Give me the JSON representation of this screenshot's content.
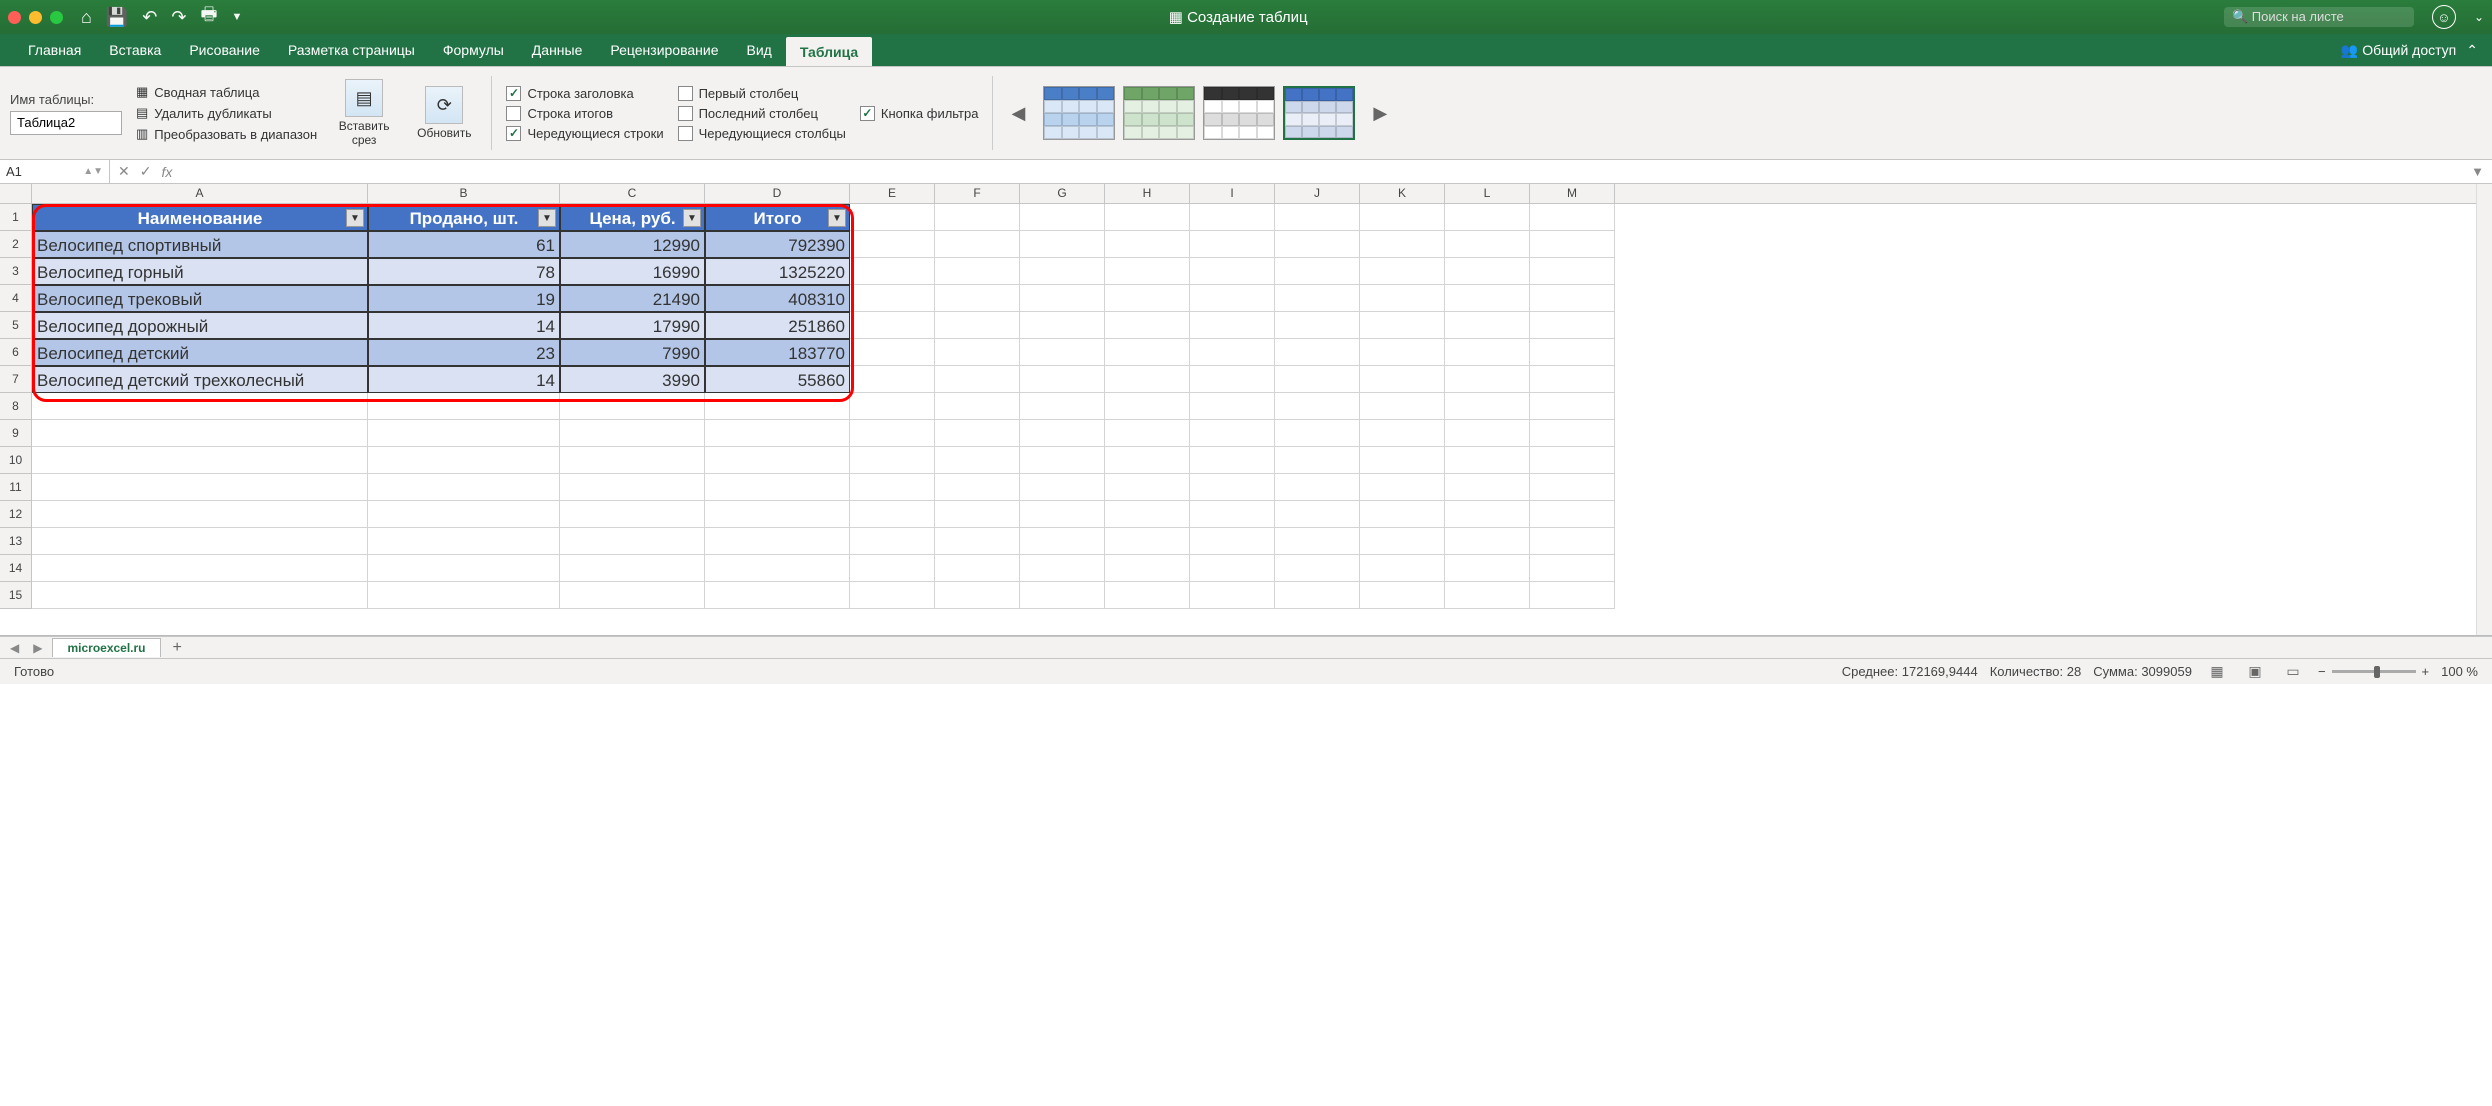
{
  "app": {
    "title": "Создание таблиц",
    "search_placeholder": "Поиск на листе"
  },
  "tabs": {
    "home": "Главная",
    "insert": "Вставка",
    "draw": "Рисование",
    "layout": "Разметка страницы",
    "formulas": "Формулы",
    "data": "Данные",
    "review": "Рецензирование",
    "view": "Вид",
    "table": "Таблица",
    "share": "Общий доступ"
  },
  "ribbon": {
    "name_label": "Имя таблицы:",
    "table_name": "Таблица2",
    "pivot": "Сводная таблица",
    "dedup": "Удалить дубликаты",
    "convert": "Преобразовать в диапазон",
    "slicer": "Вставить срез",
    "refresh": "Обновить",
    "header_row": "Строка заголовка",
    "total_row": "Строка итогов",
    "banded_rows": "Чередующиеся строки",
    "first_col": "Первый столбец",
    "last_col": "Последний столбец",
    "banded_cols": "Чередующиеся столбцы",
    "filter_btn": "Кнопка фильтра"
  },
  "namebox": "A1",
  "columns": [
    "A",
    "B",
    "C",
    "D",
    "E",
    "F",
    "G",
    "H",
    "I",
    "J",
    "K",
    "L",
    "M"
  ],
  "rows": [
    "1",
    "2",
    "3",
    "4",
    "5",
    "6",
    "7",
    "8",
    "9",
    "10",
    "11",
    "12",
    "13",
    "14",
    "15"
  ],
  "chart_data": {
    "type": "table",
    "headers": [
      "Наименование",
      "Продано, шт.",
      "Цена, руб.",
      "Итого"
    ],
    "data": [
      [
        "Велосипед спортивный",
        61,
        12990,
        792390
      ],
      [
        "Велосипед горный",
        78,
        16990,
        1325220
      ],
      [
        "Велосипед трековый",
        19,
        21490,
        408310
      ],
      [
        "Велосипед дорожный",
        14,
        17990,
        251860
      ],
      [
        "Велосипед детский",
        23,
        7990,
        183770
      ],
      [
        "Велосипед детский трехколесный",
        14,
        3990,
        55860
      ]
    ]
  },
  "sheet_tab": "microexcel.ru",
  "status": {
    "ready": "Готово",
    "avg_label": "Среднее:",
    "avg": "172169,9444",
    "cnt_label": "Количество:",
    "cnt": "28",
    "sum_label": "Сумма:",
    "sum": "3099059",
    "zoom": "100 %"
  }
}
